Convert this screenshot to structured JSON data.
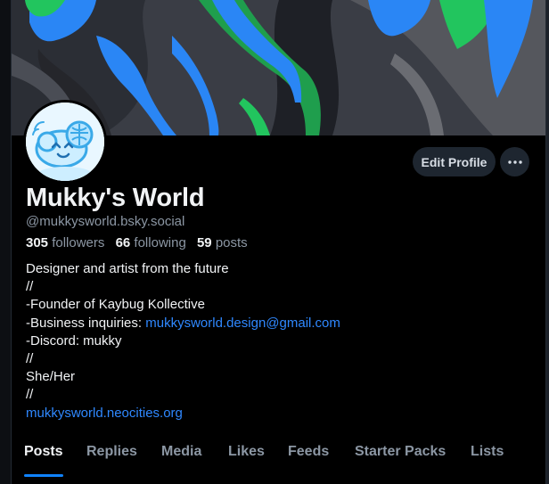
{
  "profile": {
    "display_name": "Mukky's World",
    "handle": "@mukkysworld.bsky.social",
    "stats": [
      {
        "count": "305",
        "label": "followers"
      },
      {
        "count": "66",
        "label": "following"
      },
      {
        "count": "59",
        "label": "posts"
      }
    ],
    "bio": {
      "line1": "Designer and artist from the future",
      "line2": "//",
      "line3": "-Founder of Kaybug Kollective",
      "line4_prefix": "-Business inquiries: ",
      "line4_link": "mukkysworld.design@gmail.com",
      "line5": "-Discord: mukky",
      "line6": "//",
      "line7": "She/Her",
      "line8": "//",
      "line9_link": "mukkysworld.neocities.org"
    }
  },
  "actions": {
    "edit_label": "Edit Profile",
    "more_icon": "ellipsis-icon"
  },
  "tabs": [
    "Posts",
    "Replies",
    "Media",
    "Likes",
    "Feeds",
    "Starter Packs",
    "Lists"
  ],
  "active_tab": "Posts",
  "colors": {
    "background": "#000000",
    "link": "#2f88ff",
    "muted_text": "#8c97a4",
    "button_bg": "#1e2630",
    "tab_indicator": "#1083fe"
  }
}
